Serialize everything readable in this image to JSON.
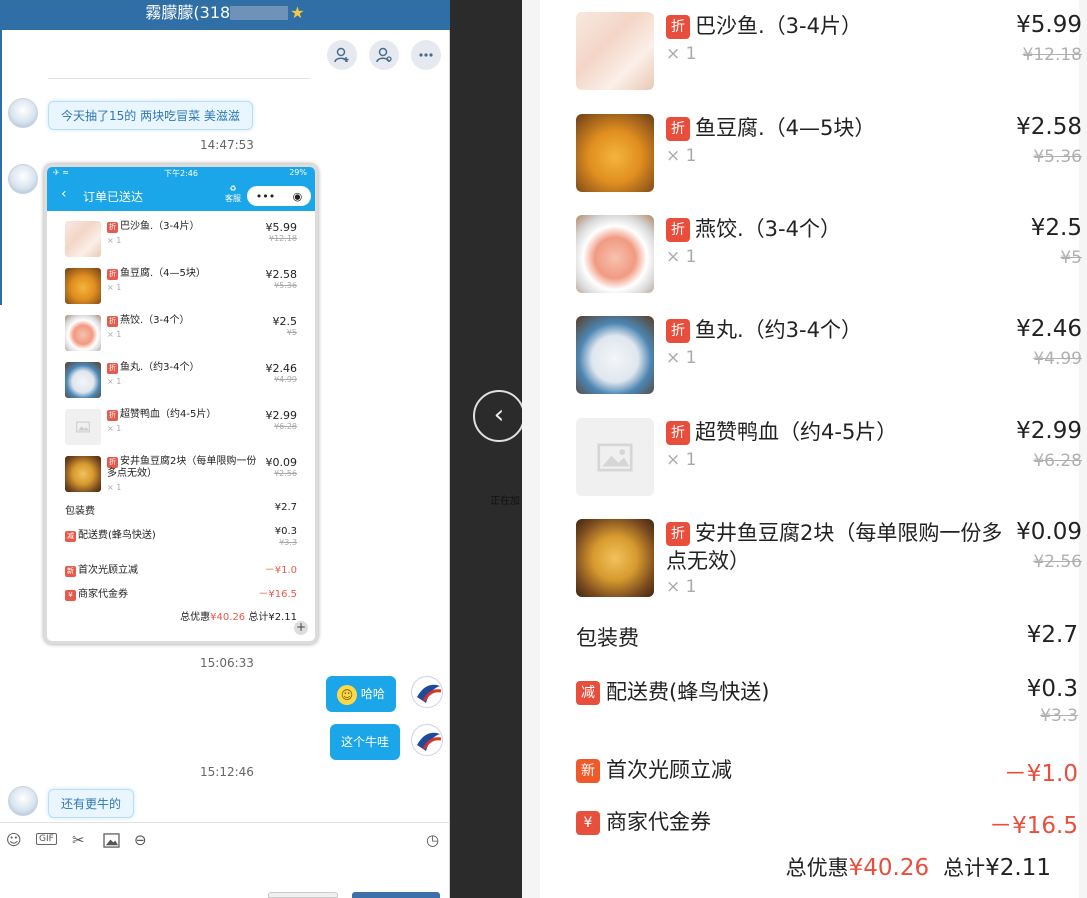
{
  "chat": {
    "title": "霧朦朦(318",
    "toolbar": [
      "add-friend",
      "user-settings",
      "more"
    ],
    "messages": [
      {
        "text": "今天抽了15的  两块吃冒菜  美滋滋"
      },
      {
        "time": "14:47:53"
      },
      {
        "time": "15:06:33"
      },
      {
        "text": "哈哈"
      },
      {
        "text": "这个牛哇"
      },
      {
        "time": "15:12:46"
      },
      {
        "text": "还有更牛的"
      }
    ],
    "input_icons": [
      "emoji-icon",
      "gif-icon",
      "scissors-icon",
      "image-icon",
      "more-icon",
      "clock-icon"
    ],
    "gif_label": "GIF"
  },
  "shot": {
    "status_time": "下午2:46",
    "status_battery": "29%",
    "title": "订单已送达",
    "service": "客服",
    "caps_dots": "•••",
    "caps_target": "◉"
  },
  "viewer": {
    "prev_arrow": "‹",
    "loading": "正在加"
  },
  "order": {
    "tag": "折",
    "items": [
      {
        "name": "巴沙鱼.（3-4片）",
        "qty": "× 1",
        "price": "¥5.99",
        "old": "¥12.18"
      },
      {
        "name": "鱼豆腐.（4—5块）",
        "qty": "× 1",
        "price": "¥2.58",
        "old": "¥5.36"
      },
      {
        "name": "燕饺.（3-4个）",
        "qty": "× 1",
        "price": "¥2.5",
        "old": "¥5"
      },
      {
        "name": "鱼丸.（约3-4个）",
        "qty": "× 1",
        "price": "¥2.46",
        "old": "¥4.99"
      },
      {
        "name": "超赞鸭血（约4-5片）",
        "qty": "× 1",
        "price": "¥2.99",
        "old": "¥6.28"
      },
      {
        "name": "安井鱼豆腐2块（每单限购一份多点无效）",
        "qty": "× 1",
        "price": "¥0.09",
        "old": "¥2.56"
      }
    ],
    "packaging": {
      "label": "包装费",
      "value": "¥2.7"
    },
    "delivery": {
      "tag": "减",
      "label": "配送费(蜂鸟快送)",
      "value": "¥0.3",
      "old": "¥3.3"
    },
    "first_visit": {
      "tag": "新",
      "label": "首次光顾立减",
      "value": "－¥1.0"
    },
    "voucher": {
      "tag": "¥",
      "label": "商家代金券",
      "value": "－¥16.5"
    },
    "total_discount_label": "总优惠",
    "total_discount": "¥40.26",
    "total_label": "总计",
    "total": "¥2.11",
    "colors": {
      "tag_red": "#e94e3d",
      "new_red": "#f05a2a",
      "voucher_red": "#e7503d"
    }
  }
}
